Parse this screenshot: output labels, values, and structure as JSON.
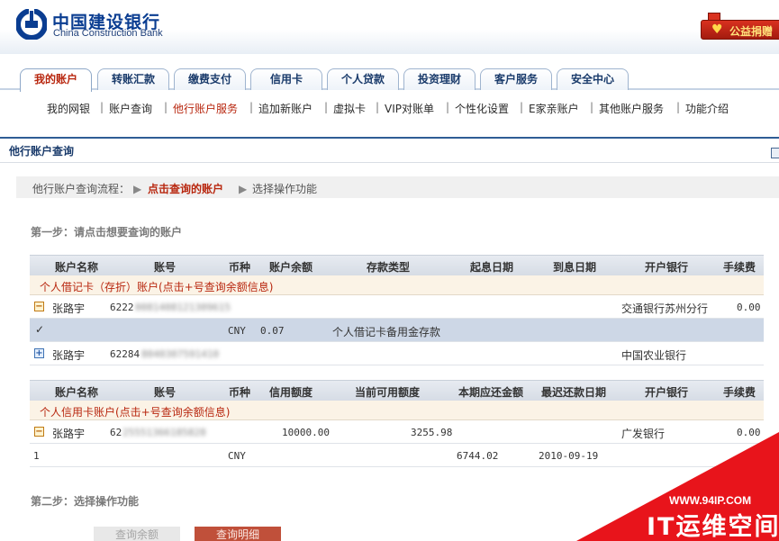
{
  "header": {
    "bank_name_cn": "中国建设银行",
    "bank_name_en": "China Construction Bank",
    "charity_label": "公益捐赠"
  },
  "tabs": [
    {
      "label": "我的账户",
      "active": true
    },
    {
      "label": "转账汇款"
    },
    {
      "label": "缴费支付"
    },
    {
      "label": "信用卡"
    },
    {
      "label": "个人贷款"
    },
    {
      "label": "投资理财"
    },
    {
      "label": "客户服务"
    },
    {
      "label": "安全中心"
    }
  ],
  "subnav": [
    "我的网银",
    "账户查询",
    "他行账户服务",
    "追加新账户",
    "虚拟卡",
    "VIP对账单",
    "个性化设置",
    "E家亲账户",
    "其他账户服务",
    "功能介绍"
  ],
  "subnav_current": "他行账户服务",
  "section_title": "他行账户查询",
  "flow": {
    "label": "他行账户查询流程：",
    "current": "点击查询的账户",
    "next": "选择操作功能"
  },
  "step1": "第一步：请点击想要查询的账户",
  "step2": "第二步：选择操作功能",
  "debit": {
    "headers": [
      "账户名称",
      "账号",
      "币种",
      "账户余额",
      "存款类型",
      "起息日期",
      "到息日期",
      "开户银行",
      "手续费"
    ],
    "category": "个人借记卡（存折）账户(点击+号查询余额信息)",
    "rows": [
      {
        "name": "张路宇",
        "acct_prefix": "6222",
        "acct_hidden": "0081408121309615",
        "bank": "交通银行苏州分行",
        "fee": "0.00"
      },
      {
        "check": "✓",
        "currency": "CNY",
        "balance": "0.07",
        "type": "个人借记卡备用金存款"
      },
      {
        "name": "张路宇",
        "acct_prefix": "62284",
        "acct_hidden": "8040307591410",
        "bank": "中国农业银行"
      }
    ]
  },
  "credit": {
    "headers": [
      "账户名称",
      "账号",
      "币种",
      "信用额度",
      "当前可用额度",
      "本期应还金额",
      "最迟还款日期",
      "开户银行",
      "手续费"
    ],
    "category": "个人信用卡账户(点击+号查询余额信息)",
    "rows": [
      {
        "name": "张路宇",
        "acct_prefix": "62",
        "acct_hidden": "25551366185828",
        "limit": "10000.00",
        "available": "3255.98",
        "bank": "广发银行",
        "fee": "0.00"
      },
      {
        "index": "1",
        "currency": "CNY",
        "due_amount": "6744.02",
        "due_date": "2010-09-19"
      }
    ]
  },
  "buttons": {
    "query_balance": "查询余额",
    "query_detail": "查询明细"
  },
  "watermark": {
    "url": "WWW.94IP.COM",
    "brand": "IT运维空间"
  },
  "colors": {
    "brand_blue": "#0a3d91",
    "active_red": "#b8270f",
    "selected_row": "#cdd7e6",
    "watermark_red": "#e8141b"
  }
}
